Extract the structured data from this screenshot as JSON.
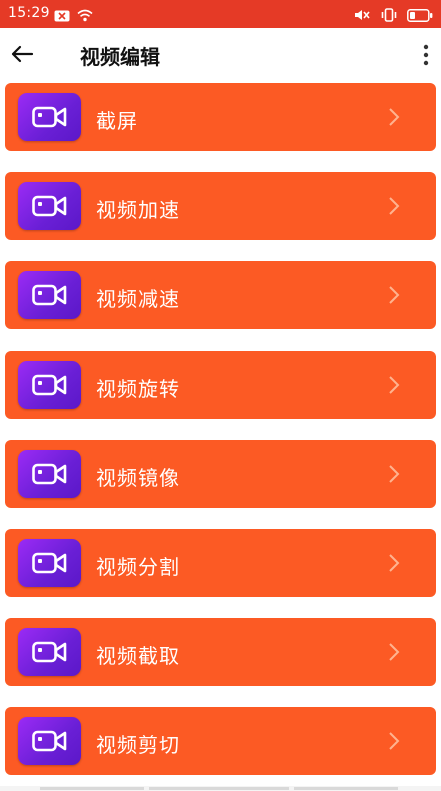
{
  "status_bar": {
    "time": "15:29",
    "background": "#e53a26"
  },
  "header": {
    "title": "视频编辑",
    "back_icon": "arrow-left-icon",
    "more_icon": "more-vertical-icon"
  },
  "menu": {
    "background": "#fc5a24",
    "icon_gradient": [
      "#9b2bf5",
      "#5b18c8"
    ],
    "items": [
      {
        "label": "截屏",
        "icon": "video-camera-icon"
      },
      {
        "label": "视频加速",
        "icon": "video-camera-icon"
      },
      {
        "label": "视频减速",
        "icon": "video-camera-icon"
      },
      {
        "label": "视频旋转",
        "icon": "video-camera-icon"
      },
      {
        "label": "视频镜像",
        "icon": "video-camera-icon"
      },
      {
        "label": "视频分割",
        "icon": "video-camera-icon"
      },
      {
        "label": "视频截取",
        "icon": "video-camera-icon"
      },
      {
        "label": "视频剪切",
        "icon": "video-camera-icon"
      }
    ]
  }
}
